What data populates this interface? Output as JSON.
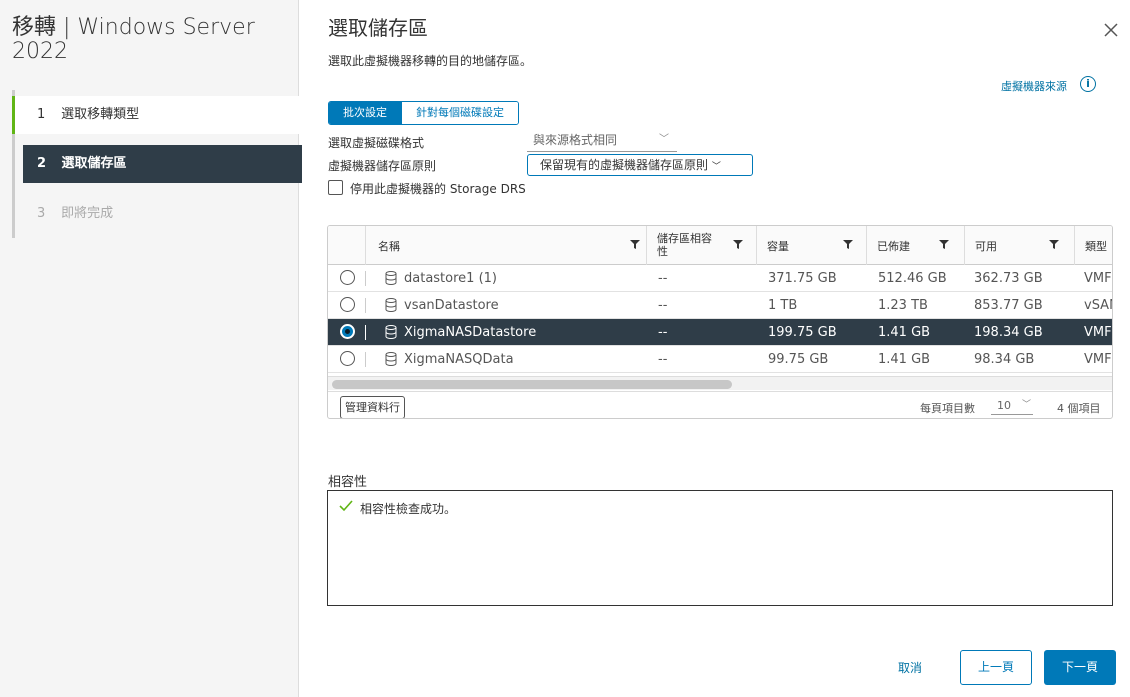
{
  "wizard": {
    "title": "移轉 | Windows Server 2022",
    "steps": [
      {
        "num": "1",
        "label": "選取移轉類型"
      },
      {
        "num": "2",
        "label": "選取儲存區"
      },
      {
        "num": "3",
        "label": "即將完成"
      }
    ]
  },
  "page": {
    "title": "選取儲存區",
    "subtitle": "選取此虛擬機器移轉的目的地儲存區。",
    "vm_origin_link": "虛擬機器來源",
    "close_icon": "close-icon",
    "info_icon": "info-icon"
  },
  "mode_tabs": {
    "batch": "批次設定",
    "per_disk": "針對每個磁碟設定"
  },
  "form": {
    "disk_format_label": "選取虛擬磁碟格式",
    "disk_format_value": "與來源格式相同",
    "storage_policy_label": "虛擬機器儲存區原則",
    "storage_policy_value": "保留現有的虛擬機器儲存區原則",
    "drs_label": "停用此虛擬機器的 Storage DRS"
  },
  "grid": {
    "columns": [
      "名稱",
      "儲存區相容性",
      "容量",
      "已佈建",
      "可用",
      "類型"
    ],
    "rows": [
      {
        "name": "datastore1 (1)",
        "compat": "--",
        "capacity": "371.75 GB",
        "provisioned": "512.46 GB",
        "free": "362.73 GB",
        "type": "VMF"
      },
      {
        "name": "vsanDatastore",
        "compat": "--",
        "capacity": "1 TB",
        "provisioned": "1.23 TB",
        "free": "853.77 GB",
        "type": "vSAN"
      },
      {
        "name": "XigmaNASDatastore",
        "compat": "--",
        "capacity": "199.75 GB",
        "provisioned": "1.41 GB",
        "free": "198.34 GB",
        "type": "VMF"
      },
      {
        "name": "XigmaNASQData",
        "compat": "--",
        "capacity": "99.75 GB",
        "provisioned": "1.41 GB",
        "free": "98.34 GB",
        "type": "VMF"
      }
    ],
    "selected_index": 2,
    "manage_columns": "管理資料行",
    "per_page_label": "每頁項目數",
    "per_page_value": "10",
    "item_count": "4 個項目"
  },
  "compatibility": {
    "label": "相容性",
    "message": "相容性檢查成功。"
  },
  "footer": {
    "cancel": "取消",
    "back": "上一頁",
    "next": "下一頁"
  },
  "colors": {
    "accent": "#0079b8",
    "selected_row": "#2f3d48",
    "success": "#60b515"
  }
}
